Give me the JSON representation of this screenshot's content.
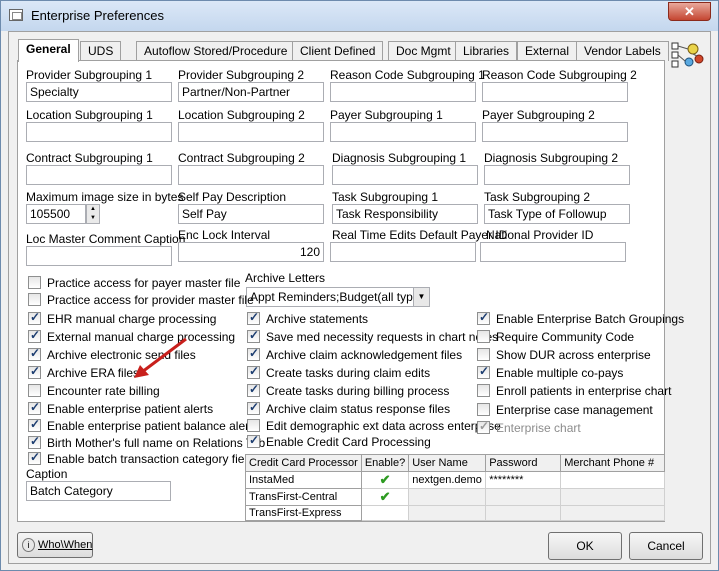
{
  "window": {
    "title": "Enterprise Preferences",
    "close_label": "✕"
  },
  "tabs": [
    "General",
    "UDS",
    "Autoflow Stored/Procedure",
    "Client Defined",
    "Doc Mgmt",
    "Libraries",
    "External",
    "Vendor Labels"
  ],
  "fields": {
    "provider_sub1": {
      "label": "Provider Subgrouping 1",
      "value": "Specialty"
    },
    "provider_sub2": {
      "label": "Provider Subgrouping 2",
      "value": "Partner/Non-Partner"
    },
    "reason_sub1": {
      "label": "Reason Code Subgrouping 1",
      "value": ""
    },
    "reason_sub2": {
      "label": "Reason Code Subgrouping 2",
      "value": ""
    },
    "location_sub1": {
      "label": "Location Subgrouping 1",
      "value": ""
    },
    "location_sub2": {
      "label": "Location Subgrouping 2",
      "value": ""
    },
    "payer_sub1": {
      "label": "Payer Subgrouping 1",
      "value": ""
    },
    "payer_sub2": {
      "label": "Payer Subgrouping 2",
      "value": ""
    },
    "contract_sub1": {
      "label": "Contract Subgrouping 1",
      "value": ""
    },
    "contract_sub2": {
      "label": "Contract Subgrouping 2",
      "value": ""
    },
    "diagnosis_sub1": {
      "label": "Diagnosis Subgrouping 1",
      "value": ""
    },
    "diagnosis_sub2": {
      "label": "Diagnosis Subgrouping 2",
      "value": ""
    },
    "max_image": {
      "label": "Maximum image size in bytes",
      "value": "105500"
    },
    "self_pay": {
      "label": "Self Pay Description",
      "value": "Self Pay"
    },
    "task_sub1": {
      "label": "Task Subgrouping 1",
      "value": "Task Responsibility"
    },
    "task_sub2": {
      "label": "Task Subgrouping 2",
      "value": "Task Type of Followup"
    },
    "loc_master": {
      "label": "Loc Master Comment Caption",
      "value": ""
    },
    "enc_lock": {
      "label": "Enc Lock Interval",
      "value": "120"
    },
    "real_time": {
      "label": "Real Time Edits Default Payer ID",
      "value": ""
    },
    "npi": {
      "label": "National Provider ID",
      "value": ""
    },
    "caption": {
      "label": "Caption",
      "value": "Batch Category"
    },
    "archive_letters": {
      "label": "Archive Letters",
      "value": "Appt Reminders;Budget(all types"
    }
  },
  "checkboxes_col1": [
    {
      "label": "Practice access for payer master file",
      "checked": false
    },
    {
      "label": "Practice access for provider master file",
      "checked": false
    },
    {
      "label": "EHR manual charge processing",
      "checked": true
    },
    {
      "label": "External manual charge processing",
      "checked": true
    },
    {
      "label": "Archive electronic send files",
      "checked": true
    },
    {
      "label": "Archive ERA files",
      "checked": true
    },
    {
      "label": "Encounter rate billing",
      "checked": false
    },
    {
      "label": "Enable enterprise patient alerts",
      "checked": true
    },
    {
      "label": "Enable enterprise patient balance alerts",
      "checked": true
    },
    {
      "label": "Birth Mother's full name on Relations Tab",
      "checked": true
    },
    {
      "label": "Enable batch transaction category field",
      "checked": true
    }
  ],
  "checkboxes_col2": [
    {
      "label": "Archive statements",
      "checked": true
    },
    {
      "label": "Save med necessity requests in chart notes",
      "checked": true
    },
    {
      "label": "Archive claim acknowledgement files",
      "checked": true
    },
    {
      "label": "Create tasks during claim edits",
      "checked": true
    },
    {
      "label": "Create tasks during billing process",
      "checked": true
    },
    {
      "label": "Archive claim status response files",
      "checked": true
    },
    {
      "label": "Edit demographic ext data across enterprise",
      "checked": false
    },
    {
      "label": "Enable Credit Card Processing",
      "checked": true
    }
  ],
  "checkboxes_col3": [
    {
      "label": "Enable Enterprise Batch Groupings",
      "checked": true,
      "disabled": false
    },
    {
      "label": "Require Community Code",
      "checked": false,
      "disabled": false
    },
    {
      "label": "Show DUR across enterprise",
      "checked": false,
      "disabled": false
    },
    {
      "label": "Enable multiple co-pays",
      "checked": true,
      "disabled": false
    },
    {
      "label": "Enroll patients in enterprise chart",
      "checked": false,
      "disabled": false
    },
    {
      "label": "Enterprise case management",
      "checked": false,
      "disabled": false
    },
    {
      "label": "Enterprise chart",
      "checked": true,
      "disabled": true
    }
  ],
  "cc_table": {
    "headers": [
      "Credit Card Processor",
      "Enable?",
      "User Name",
      "Password",
      "Merchant Phone #"
    ],
    "rows": [
      {
        "processor": "InstaMed",
        "enabled": true,
        "user": "nextgen.demo",
        "password": "********",
        "phone": ""
      },
      {
        "processor": "TransFirst-Central",
        "enabled": true,
        "user": "",
        "password": "",
        "phone": ""
      },
      {
        "processor": "TransFirst-Express",
        "enabled": false,
        "user": "",
        "password": "",
        "phone": ""
      }
    ]
  },
  "buttons": {
    "whowhen": "Who\\When",
    "ok": "OK",
    "cancel": "Cancel"
  },
  "colors": {
    "arrow": "#c8201c",
    "accent_green": "#2e9b22"
  }
}
